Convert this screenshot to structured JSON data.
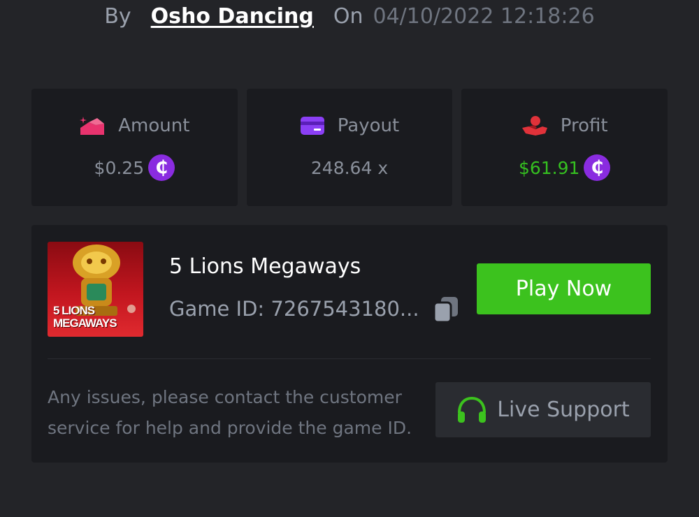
{
  "byline": {
    "by_label": "By",
    "author": "Osho Dancing",
    "on_label": "On",
    "datetime": "04/10/2022 12:18:26"
  },
  "stats": {
    "amount": {
      "label": "Amount",
      "value": "$0.25",
      "icon": "amount-icon",
      "coin": "₵"
    },
    "payout": {
      "label": "Payout",
      "value": "248.64 x",
      "icon": "card-icon"
    },
    "profit": {
      "label": "Profit",
      "value": "$61.91",
      "icon": "hand-coin-icon",
      "coin": "₵"
    }
  },
  "game": {
    "thumb_text_line1": "5 LIONS",
    "thumb_text_line2": "MEGAWAYS",
    "title": "5 Lions Megaways",
    "id_text": "Game ID: 7267543180...",
    "play_label": "Play Now"
  },
  "support": {
    "message": "Any issues, please contact the customer service for help and provide the game ID.",
    "button_label": "Live Support"
  },
  "colors": {
    "background": "#232428",
    "card": "#1a1b1f",
    "accent_green": "#3cc21e",
    "profit_green": "#35c020",
    "coin_purple": "#8a2ce0",
    "amount_pink": "#e8336e",
    "payout_purple": "#8b3ff5",
    "profit_red": "#e0323a"
  }
}
